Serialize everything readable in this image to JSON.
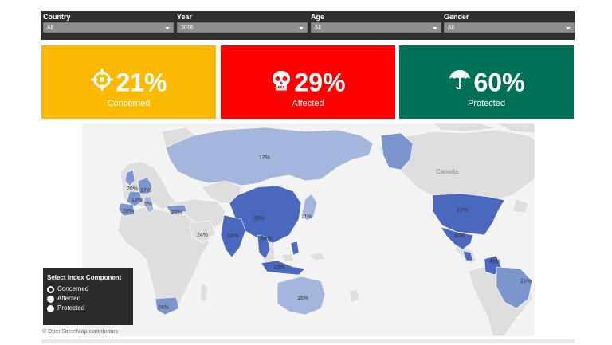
{
  "filters": [
    {
      "label": "Country",
      "value": "All"
    },
    {
      "label": "Year",
      "value": "2016"
    },
    {
      "label": "Age",
      "value": "All"
    },
    {
      "label": "Gender",
      "value": "All"
    }
  ],
  "tiles": [
    {
      "value": "21%",
      "label": "Concerned",
      "color": "#fbba00",
      "icon": "target-icon"
    },
    {
      "value": "29%",
      "label": "Affected",
      "color": "#ff0000",
      "icon": "skull-icon"
    },
    {
      "value": "60%",
      "label": "Protected",
      "color": "#007056",
      "icon": "umbrella-icon"
    }
  ],
  "map": {
    "place_label": "Canada",
    "region_values": {
      "russia": "17%",
      "uk": "20%",
      "germany": "17%",
      "france": "13%",
      "switzerland": "5%",
      "spain": "28%",
      "turkey": "23%",
      "saudi_arabia": "24%",
      "china": "36%",
      "japan": "11%",
      "india": "33%",
      "thailand": "33%",
      "indonesia": "19%",
      "australia": "16%",
      "south_africa": "24%",
      "usa": "27%",
      "mexico": "40%",
      "colombia": "48%",
      "brazil": "21%"
    },
    "colors": {
      "land": "#dedede",
      "ocean": "#f3f3f3",
      "light": "#a5b6dc",
      "medium": "#7c95cd",
      "dark": "#4a68bd"
    }
  },
  "legend": {
    "title": "Select Index Component",
    "options": [
      "Concerned",
      "Affected",
      "Protected"
    ],
    "selected": "Concerned"
  },
  "attribution": "© OpenStreetMap contributors"
}
